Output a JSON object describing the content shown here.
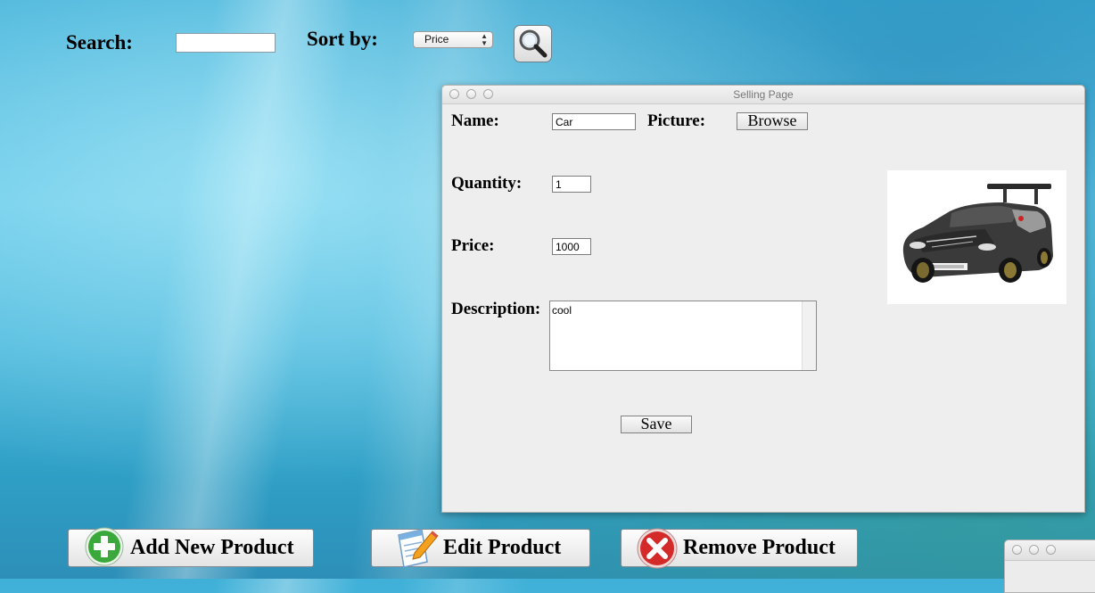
{
  "toolbar": {
    "search_label": "Search:",
    "search_value": "",
    "sort_label": "Sort by:",
    "sort_selected": "Price"
  },
  "selling_window": {
    "title": "Selling Page",
    "name_label": "Name:",
    "name_value": "Car",
    "picture_label": "Picture:",
    "browse_label": "Browse",
    "quantity_label": "Quantity:",
    "quantity_value": "1",
    "price_label": "Price:",
    "price_value": "1000",
    "description_label": "Description:",
    "description_value": "cool",
    "save_label": "Save"
  },
  "actions": {
    "add_label": "Add New Product",
    "edit_label": "Edit Product",
    "remove_label": "Remove Product"
  },
  "icons": {
    "search": "magnifier-icon",
    "add": "plus-circle-icon",
    "edit": "notepad-pencil-icon",
    "remove": "x-circle-icon"
  },
  "colors": {
    "add_green": "#3aa83a",
    "remove_red": "#d42a2a"
  }
}
